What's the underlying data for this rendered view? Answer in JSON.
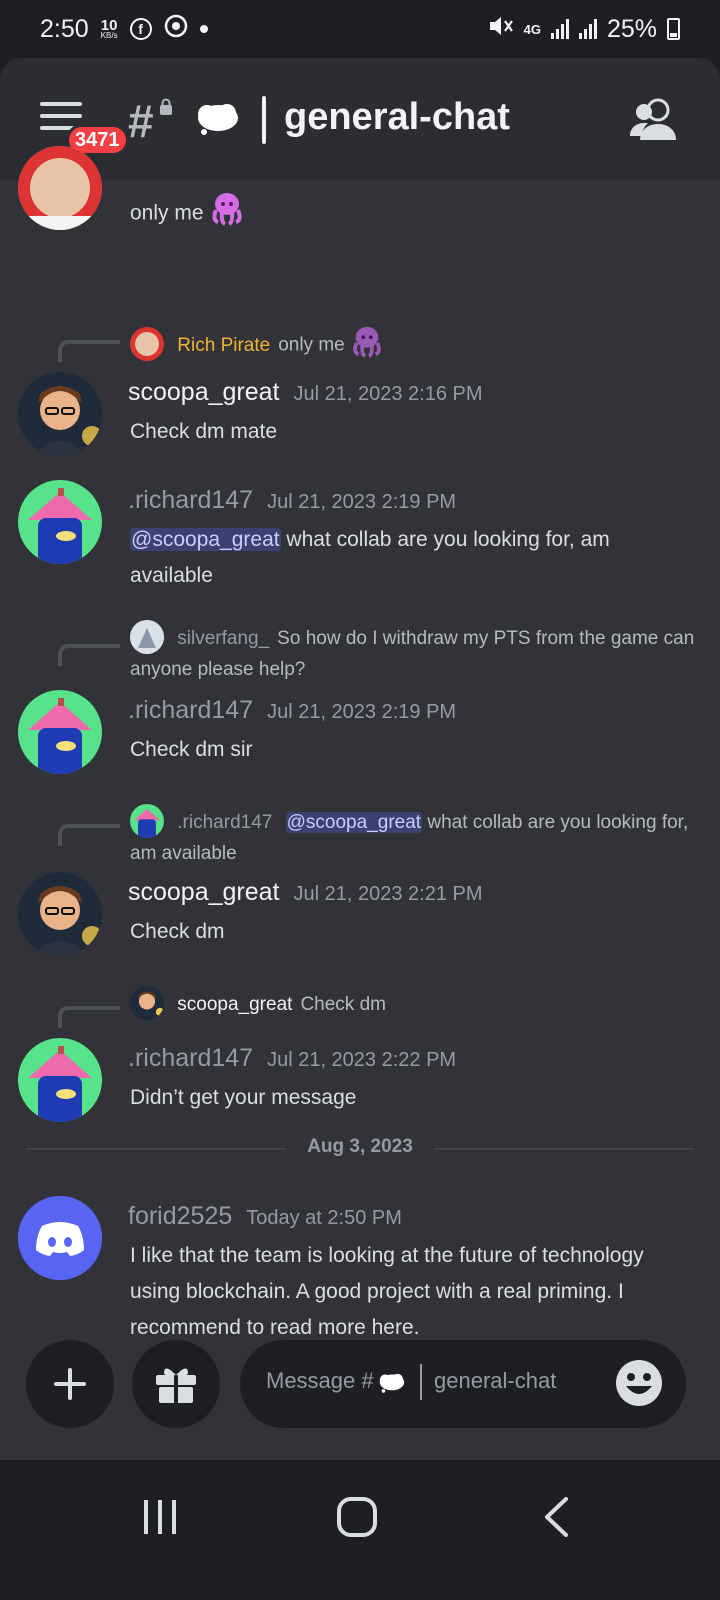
{
  "status_bar": {
    "time": "2:50",
    "data_speed_value": "10",
    "data_speed_unit": "KB/s",
    "icons": [
      "facebook-icon",
      "chrome-icon",
      "dot-icon",
      "mute-icon",
      "4g-icon",
      "signal-icon",
      "signal-icon"
    ],
    "network": "4G",
    "battery": "25%"
  },
  "header": {
    "unread_badge": "3471",
    "channel_name": "general-chat"
  },
  "messages": [
    {
      "text": "only me",
      "emoji": "octopus"
    },
    {
      "reply": {
        "name": "Rich Pirate",
        "text": "only me",
        "emoji": "octopus"
      },
      "author": "scoopa_great",
      "timestamp": "Jul 21, 2023 2:16 PM",
      "text": "Check dm mate"
    },
    {
      "author": ".richard147",
      "timestamp": "Jul 21, 2023 2:19 PM",
      "mention": "@scoopa_great",
      "text": " what collab are you looking for, am available"
    },
    {
      "reply": {
        "name": "silverfang_",
        "text": "So how do I withdraw my PTS from the game can anyone please help?"
      },
      "author": ".richard147",
      "timestamp": "Jul 21, 2023 2:19 PM",
      "text": "Check dm sir"
    },
    {
      "reply": {
        "name": ".richard147",
        "mention": "@scoopa_great",
        "text": " what collab are you looking for, am available"
      },
      "author": "scoopa_great",
      "timestamp": "Jul 21, 2023 2:21 PM",
      "text": "Check dm"
    },
    {
      "reply": {
        "name": "scoopa_great",
        "text": "Check dm"
      },
      "author": ".richard147",
      "timestamp": "Jul 21, 2023 2:22 PM",
      "text": "Didn’t get your message"
    },
    {
      "author": "forid2525",
      "timestamp": "Today at 2:50 PM",
      "text": "I like that the team is looking at the future of technology using blockchain. A good project with a real priming. I recommend to read more here."
    }
  ],
  "date_separator": "Aug 3, 2023",
  "composer": {
    "placeholder_prefix": "Message #",
    "placeholder_channel": "general-chat"
  },
  "colors": {
    "background": "#313338",
    "header": "#2b2d31",
    "accent": "#5865f2",
    "badge": "#f23f43",
    "rich_pirate_name": "#f0b232"
  }
}
